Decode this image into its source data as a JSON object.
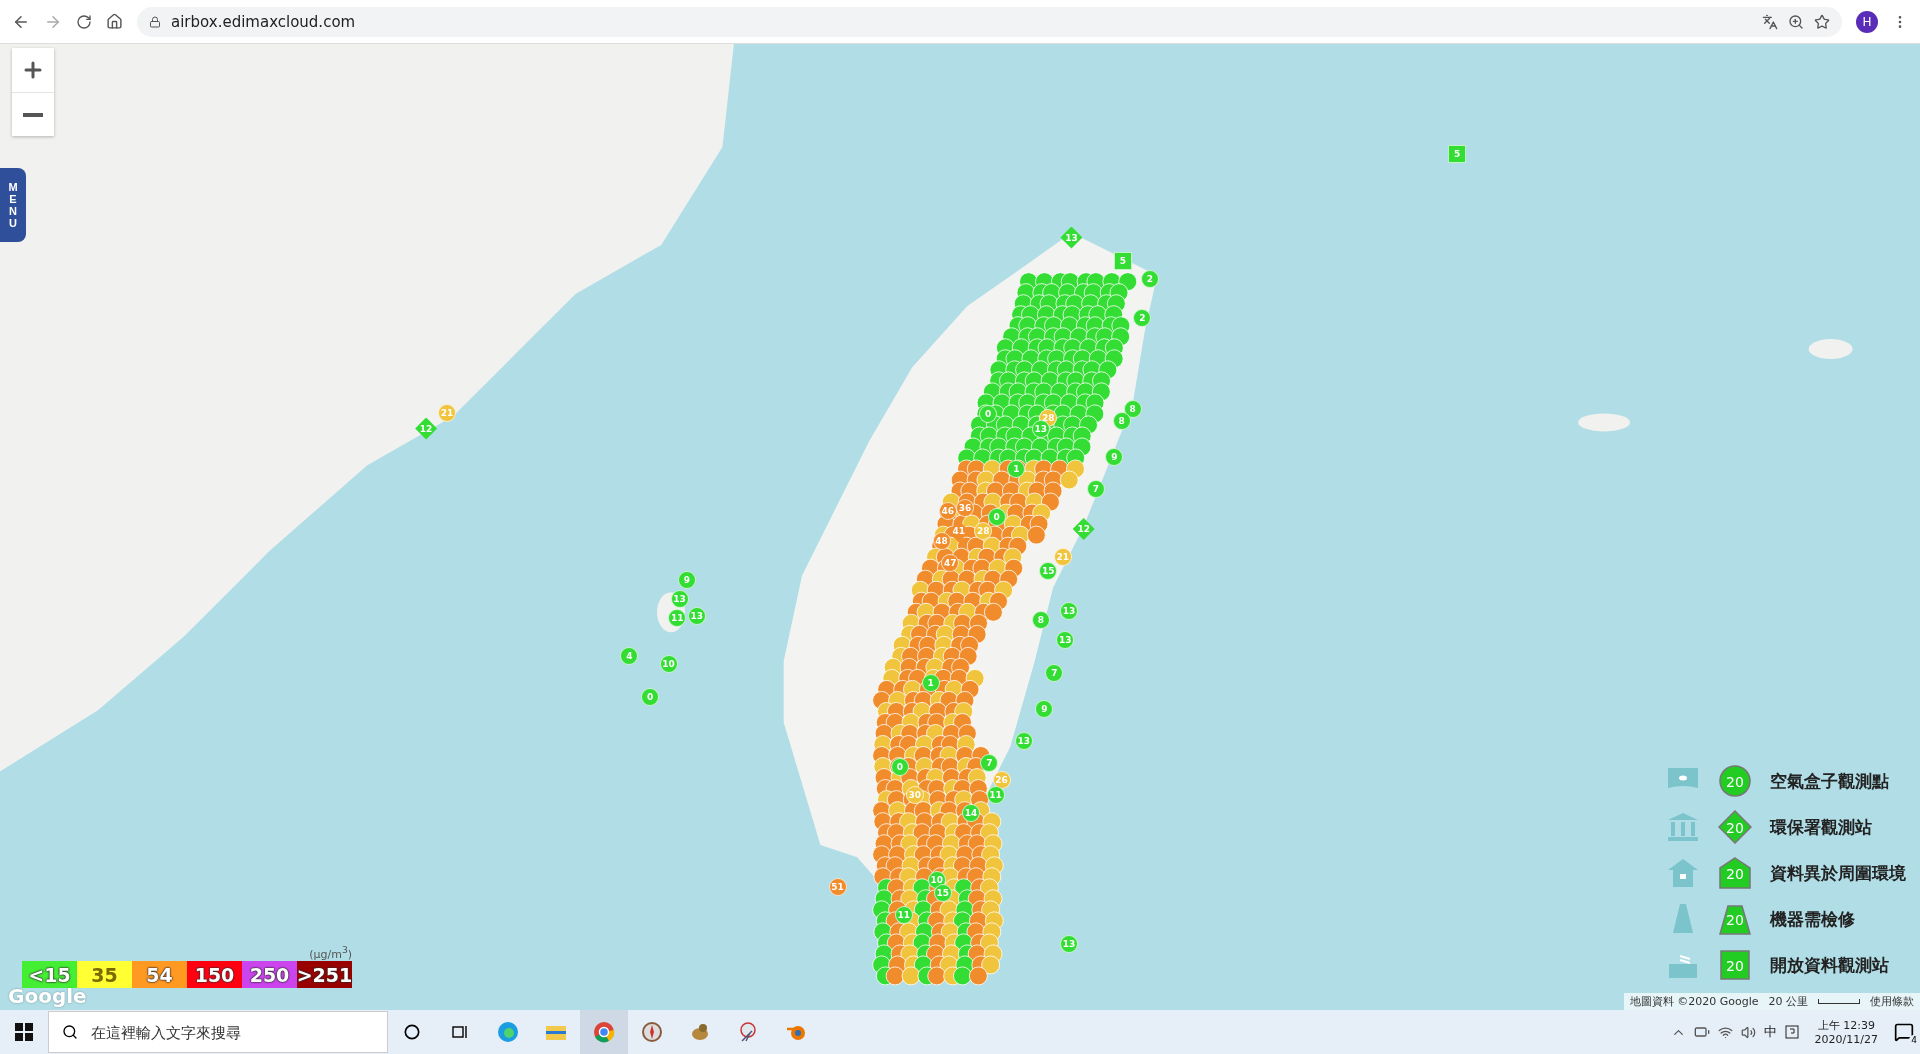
{
  "browser": {
    "address": "airbox.edimaxcloud.com",
    "profile": "H"
  },
  "map": {
    "menu": "MENU",
    "markers": [
      {
        "kind": "square",
        "value": "5",
        "color": "#33dd33"
      },
      {
        "kind": "diamond",
        "value": "13",
        "color": "#33dd33"
      },
      {
        "kind": "square",
        "value": "5",
        "color": "#33dd33"
      },
      {
        "kind": "circle",
        "value": "2",
        "color": "#33dd33"
      },
      {
        "kind": "circle",
        "value": "2",
        "color": "#33dd33"
      },
      {
        "kind": "circle",
        "value": "8",
        "color": "#33dd33"
      },
      {
        "kind": "circle",
        "value": "8",
        "color": "#33dd33"
      },
      {
        "kind": "circle",
        "value": "0",
        "color": "#33dd33"
      },
      {
        "kind": "circle",
        "value": "28",
        "color": "#f0c43c"
      },
      {
        "kind": "circle",
        "value": "13",
        "color": "#33dd33"
      },
      {
        "kind": "circle",
        "value": "1",
        "color": "#33dd33"
      },
      {
        "kind": "circle",
        "value": "9",
        "color": "#33dd33"
      },
      {
        "kind": "circle",
        "value": "7",
        "color": "#33dd33"
      },
      {
        "kind": "diamond",
        "value": "12",
        "color": "#33dd33"
      },
      {
        "kind": "circle",
        "value": "46",
        "color": "#f08c2c"
      },
      {
        "kind": "circle",
        "value": "36",
        "color": "#f08c2c"
      },
      {
        "kind": "circle",
        "value": "0",
        "color": "#33dd33"
      },
      {
        "kind": "diamond",
        "value": "41",
        "color": "#f08c2c"
      },
      {
        "kind": "circle",
        "value": "28",
        "color": "#f0c43c"
      },
      {
        "kind": "circle",
        "value": "48",
        "color": "#f08c2c"
      },
      {
        "kind": "circle",
        "value": "47",
        "color": "#f08c2c"
      },
      {
        "kind": "circle",
        "value": "21",
        "color": "#f0c43c"
      },
      {
        "kind": "circle",
        "value": "15",
        "color": "#33dd33"
      },
      {
        "kind": "circle",
        "value": "13",
        "color": "#33dd33"
      },
      {
        "kind": "circle",
        "value": "8",
        "color": "#33dd33"
      },
      {
        "kind": "circle",
        "value": "13",
        "color": "#33dd33"
      },
      {
        "kind": "circle",
        "value": "7",
        "color": "#33dd33"
      },
      {
        "kind": "circle",
        "value": "1",
        "color": "#33dd33"
      },
      {
        "kind": "circle",
        "value": "9",
        "color": "#33dd33"
      },
      {
        "kind": "circle",
        "value": "13",
        "color": "#33dd33"
      },
      {
        "kind": "circle",
        "value": "7",
        "color": "#33dd33"
      },
      {
        "kind": "circle",
        "value": "0",
        "color": "#33dd33"
      },
      {
        "kind": "circle",
        "value": "26",
        "color": "#f0c43c"
      },
      {
        "kind": "circle",
        "value": "11",
        "color": "#33dd33"
      },
      {
        "kind": "circle",
        "value": "30",
        "color": "#f0c43c"
      },
      {
        "kind": "circle",
        "value": "14",
        "color": "#33dd33"
      },
      {
        "kind": "circle",
        "value": "10",
        "color": "#33dd33"
      },
      {
        "kind": "circle",
        "value": "15",
        "color": "#33dd33"
      },
      {
        "kind": "circle",
        "value": "11",
        "color": "#33dd33"
      },
      {
        "kind": "circle",
        "value": "51",
        "color": "#f08c2c"
      },
      {
        "kind": "circle",
        "value": "13",
        "color": "#33dd33"
      },
      {
        "kind": "circle",
        "value": "9",
        "color": "#33dd33"
      },
      {
        "kind": "circle",
        "value": "13",
        "color": "#33dd33"
      },
      {
        "kind": "circle",
        "value": "11",
        "color": "#33dd33"
      },
      {
        "kind": "circle",
        "value": "13",
        "color": "#33dd33"
      },
      {
        "kind": "circle",
        "value": "4",
        "color": "#33dd33"
      },
      {
        "kind": "circle",
        "value": "10",
        "color": "#33dd33"
      },
      {
        "kind": "circle",
        "value": "0",
        "color": "#33dd33"
      },
      {
        "kind": "diamond",
        "value": "12",
        "color": "#33dd33"
      },
      {
        "kind": "circle",
        "value": "21",
        "color": "#f0c43c"
      }
    ],
    "legend": [
      {
        "kind": "box",
        "value": "20",
        "label": "空氣盒子觀測點"
      },
      {
        "kind": "epa",
        "value": "20",
        "label": "環保署觀測站"
      },
      {
        "kind": "anomaly",
        "value": "20",
        "label": "資料異於周圍環境"
      },
      {
        "kind": "repair",
        "value": "20",
        "label": "機器需檢修"
      },
      {
        "kind": "open",
        "value": "20",
        "label": "開放資料觀測站"
      }
    ],
    "scale": {
      "unit": "(μg/m$^{3}$)",
      "steps": [
        {
          "label": "<15",
          "color": "#44ee33"
        },
        {
          "label": "35",
          "color": "#ffff33"
        },
        {
          "label": "54",
          "color": "#ff9922"
        },
        {
          "label": "150",
          "color": "#ff0011"
        },
        {
          "label": "250",
          "color": "#cc44ee"
        },
        {
          "label": ">251",
          "color": "#990000"
        }
      ]
    },
    "logo": "Google",
    "attribution": {
      "data": "地圖資料 ©2020 Google",
      "distance": "20 公里",
      "terms": "使用條款"
    }
  },
  "taskbar": {
    "search_placeholder": "在這裡輸入文字來搜尋",
    "ime": "中",
    "time": "上午 12:39",
    "date": "2020/11/27",
    "notifications": "4"
  }
}
